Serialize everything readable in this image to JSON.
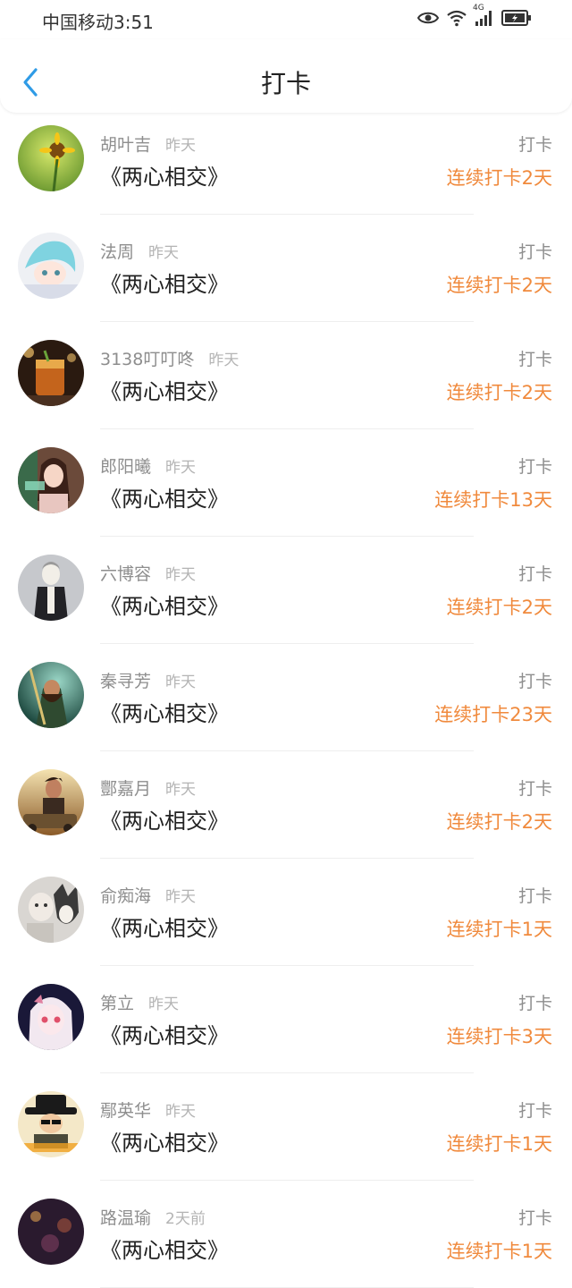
{
  "status_bar": {
    "carrier_time": "中国移动3:51",
    "network": "4G"
  },
  "nav": {
    "title": "打卡"
  },
  "items": [
    {
      "name": "胡叶吉",
      "time": "昨天",
      "book": "《两心相交》",
      "action": "打卡",
      "streak": "连续打卡2天"
    },
    {
      "name": "法周",
      "time": "昨天",
      "book": "《两心相交》",
      "action": "打卡",
      "streak": "连续打卡2天"
    },
    {
      "name": "3138叮叮咚",
      "time": "昨天",
      "book": "《两心相交》",
      "action": "打卡",
      "streak": "连续打卡2天"
    },
    {
      "name": "郎阳曦",
      "time": "昨天",
      "book": "《两心相交》",
      "action": "打卡",
      "streak": "连续打卡13天"
    },
    {
      "name": "六博容",
      "time": "昨天",
      "book": "《两心相交》",
      "action": "打卡",
      "streak": "连续打卡2天"
    },
    {
      "name": "秦寻芳",
      "time": "昨天",
      "book": "《两心相交》",
      "action": "打卡",
      "streak": "连续打卡23天"
    },
    {
      "name": "酆嘉月",
      "time": "昨天",
      "book": "《两心相交》",
      "action": "打卡",
      "streak": "连续打卡2天"
    },
    {
      "name": "俞痴海",
      "time": "昨天",
      "book": "《两心相交》",
      "action": "打卡",
      "streak": "连续打卡1天"
    },
    {
      "name": "第立",
      "time": "昨天",
      "book": "《两心相交》",
      "action": "打卡",
      "streak": "连续打卡3天"
    },
    {
      "name": "鄢英华",
      "time": "昨天",
      "book": "《两心相交》",
      "action": "打卡",
      "streak": "连续打卡1天"
    },
    {
      "name": "路温瑜",
      "time": "2天前",
      "book": "《两心相交》",
      "action": "打卡",
      "streak": "连续打卡1天"
    }
  ],
  "colors": {
    "accent": "#f08a3d",
    "back_icon": "#2f9be6",
    "muted_text": "#8e8e8e"
  }
}
